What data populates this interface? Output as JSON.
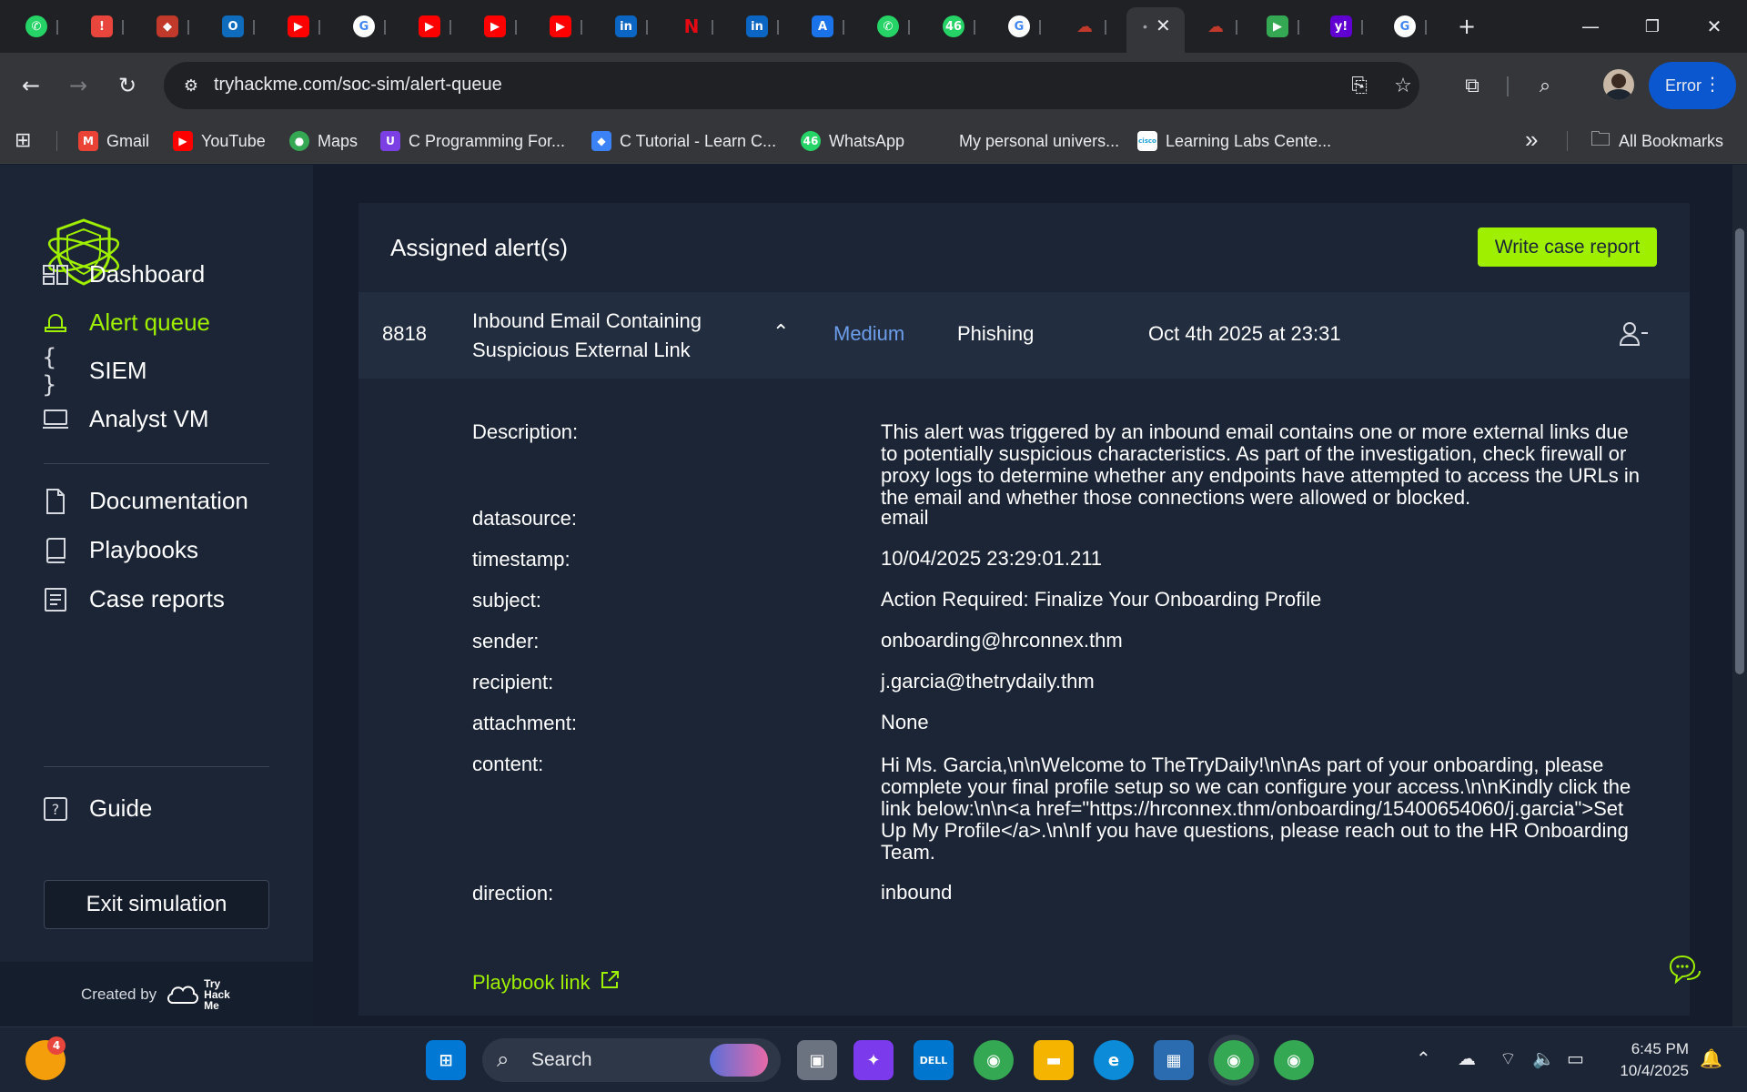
{
  "browser": {
    "url": "tryhackme.com/soc-sim/alert-queue",
    "profile_label": "Error",
    "tab_close_glyph": "✕",
    "new_tab_glyph": "+",
    "tabs": [
      {
        "icon": "whatsapp-icon",
        "color": "#25d366",
        "glyph": "✆"
      },
      {
        "icon": "alert-icon",
        "color": "#e8453c",
        "glyph": "!"
      },
      {
        "icon": "hacker-icon",
        "color": "#c0392b",
        "glyph": "◆"
      },
      {
        "icon": "outlook-icon",
        "color": "#0f6cbd",
        "glyph": "O"
      },
      {
        "icon": "youtube-icon",
        "color": "#ff0000",
        "glyph": "▶"
      },
      {
        "icon": "google-icon",
        "color": "#ffffff",
        "glyph": "G"
      },
      {
        "icon": "youtube-icon",
        "color": "#ff0000",
        "glyph": "▶"
      },
      {
        "icon": "youtube-icon",
        "color": "#ff0000",
        "glyph": "▶"
      },
      {
        "icon": "youtube-icon",
        "color": "#ff0000",
        "glyph": "▶"
      },
      {
        "icon": "linkedin-icon",
        "color": "#0a66c2",
        "glyph": "in"
      },
      {
        "icon": "netflix-icon",
        "color": "#202124",
        "glyph": "N"
      },
      {
        "icon": "linkedin-icon",
        "color": "#0a66c2",
        "glyph": "in"
      },
      {
        "icon": "a-app-icon",
        "color": "#1a73e8",
        "glyph": "A"
      },
      {
        "icon": "whatsapp-icon",
        "color": "#25d366",
        "glyph": "✆"
      },
      {
        "icon": "whatsapp-badge-icon",
        "color": "#25d366",
        "glyph": "46"
      },
      {
        "icon": "google-icon",
        "color": "#ffffff",
        "glyph": "G"
      },
      {
        "icon": "tryhackme-cloud-icon",
        "color": "#202124",
        "glyph": "☁"
      },
      {
        "icon": "tryhackme-cloud-icon",
        "color": "#35363a",
        "glyph": "☁"
      },
      {
        "icon": "tryhackme-cloud-icon",
        "color": "#202124",
        "glyph": "☁"
      },
      {
        "icon": "terminal-icon",
        "color": "#34a853",
        "glyph": "▶"
      },
      {
        "icon": "yahoo-icon",
        "color": "#6001d2",
        "glyph": "y!"
      },
      {
        "icon": "google-icon",
        "color": "#ffffff",
        "glyph": "G"
      }
    ],
    "bookmarks": [
      {
        "label": "Gmail",
        "icon": "gmail-icon",
        "color": "#ea4335",
        "glyph": "M"
      },
      {
        "label": "YouTube",
        "icon": "youtube-icon",
        "color": "#ff0000",
        "glyph": "▶"
      },
      {
        "label": "Maps",
        "icon": "maps-icon",
        "color": "#34a853",
        "glyph": "●"
      },
      {
        "label": "C Programming For...",
        "icon": "c-course-icon",
        "color": "#7b3fe4",
        "glyph": "U"
      },
      {
        "label": "C Tutorial - Learn C...",
        "icon": "c-tutorial-icon",
        "color": "#3b82f6",
        "glyph": "◆"
      },
      {
        "label": "WhatsApp",
        "icon": "whatsapp-icon",
        "color": "#25d366",
        "glyph": "46"
      },
      {
        "label": "My personal univers...",
        "icon": "",
        "color": "",
        "glyph": ""
      },
      {
        "label": "Learning Labs Cente...",
        "icon": "cisco-icon",
        "color": "#ffffff",
        "glyph": "cisco"
      }
    ],
    "more_bookmarks_glyph": "»",
    "all_bookmarks": "All Bookmarks"
  },
  "sidebar": {
    "items": [
      {
        "label": "Dashboard",
        "icon": "dashboard-icon",
        "glyph": "▭"
      },
      {
        "label": "Alert queue",
        "icon": "alert-light-icon",
        "glyph": "⏏"
      },
      {
        "label": "SIEM",
        "icon": "braces-icon",
        "glyph": "{ }"
      },
      {
        "label": "Analyst VM",
        "icon": "monitor-icon",
        "glyph": "▭"
      },
      {
        "label": "Documentation",
        "icon": "document-icon",
        "glyph": "▯"
      },
      {
        "label": "Playbooks",
        "icon": "book-icon",
        "glyph": "▯"
      },
      {
        "label": "Case reports",
        "icon": "report-icon",
        "glyph": "≣"
      },
      {
        "label": "Guide",
        "icon": "question-icon",
        "glyph": "?"
      }
    ],
    "exit_label": "Exit simulation",
    "created_by": "Created by",
    "logo_text": [
      "Try",
      "Hack",
      "Me"
    ]
  },
  "panel": {
    "title": "Assigned alert(s)",
    "report_button": "Write case report",
    "alert": {
      "id": "8818",
      "title_line1": "Inbound Email Containing",
      "title_line2": "Suspicious External Link",
      "severity": "Medium",
      "type": "Phishing",
      "time": "Oct 4th 2025 at 23:31",
      "chevron": "⌃"
    },
    "details": [
      {
        "label": "Description:",
        "value": "This alert was triggered by an inbound email contains one or more external links due to potentially suspicious characteristics. As part of the investigation, check firewall or proxy logs to determine whether any endpoints have attempted to access the URLs in the email and whether those connections were allowed or blocked."
      },
      {
        "label": "datasource:",
        "value": "email"
      },
      {
        "label": "timestamp:",
        "value": "10/04/2025 23:29:01.211"
      },
      {
        "label": "subject:",
        "value": "Action Required: Finalize Your Onboarding Profile"
      },
      {
        "label": "sender:",
        "value": "onboarding@hrconnex.thm"
      },
      {
        "label": "recipient:",
        "value": "j.garcia@thetrydaily.thm"
      },
      {
        "label": "attachment:",
        "value": "None"
      },
      {
        "label": "content:",
        "value": "Hi Ms. Garcia,\\n\\nWelcome to TheTryDaily!\\n\\nAs part of your onboarding, please complete your final profile setup so we can configure your access.\\n\\nKindly click the link below:\\n\\n<a href=\"https://hrconnex.thm/onboarding/15400654060/j.garcia\">Set Up My Profile</a>.\\n\\nIf you have questions, please reach out to the HR Onboarding Team."
      },
      {
        "label": "direction:",
        "value": "inbound"
      }
    ],
    "playbook_link": "Playbook link"
  },
  "taskbar": {
    "search_label": "Search",
    "weather_badge": "4",
    "time": "6:45 PM",
    "date": "10/4/2025",
    "apps": [
      {
        "icon": "windows-start-icon",
        "color": "#0078d4",
        "glyph": "⊞"
      },
      {
        "icon": "task-view-icon",
        "color": "#6b7280",
        "glyph": "▣"
      },
      {
        "icon": "copilot-icon",
        "color": "#7c3aed",
        "glyph": "✦"
      },
      {
        "icon": "dell-icon",
        "color": "#0076ce",
        "glyph": "DELL"
      },
      {
        "icon": "chrome-icon",
        "color": "#34a853",
        "glyph": "◉"
      },
      {
        "icon": "file-explorer-icon",
        "color": "#f4b400",
        "glyph": "▬"
      },
      {
        "icon": "edge-icon",
        "color": "#0b8bd8",
        "glyph": "e"
      },
      {
        "icon": "ms-store-icon",
        "color": "#2b6cb0",
        "glyph": "▦"
      },
      {
        "icon": "chrome-profile-icon",
        "color": "#34a853",
        "glyph": "◉"
      },
      {
        "icon": "chrome-profile-2-icon",
        "color": "#34a853",
        "glyph": "◉"
      }
    ]
  },
  "colors": {
    "accent": "#9fef00",
    "severity_medium": "#6d9eeb",
    "panel_bg": "#1b2536",
    "row_bg": "#222d40"
  }
}
